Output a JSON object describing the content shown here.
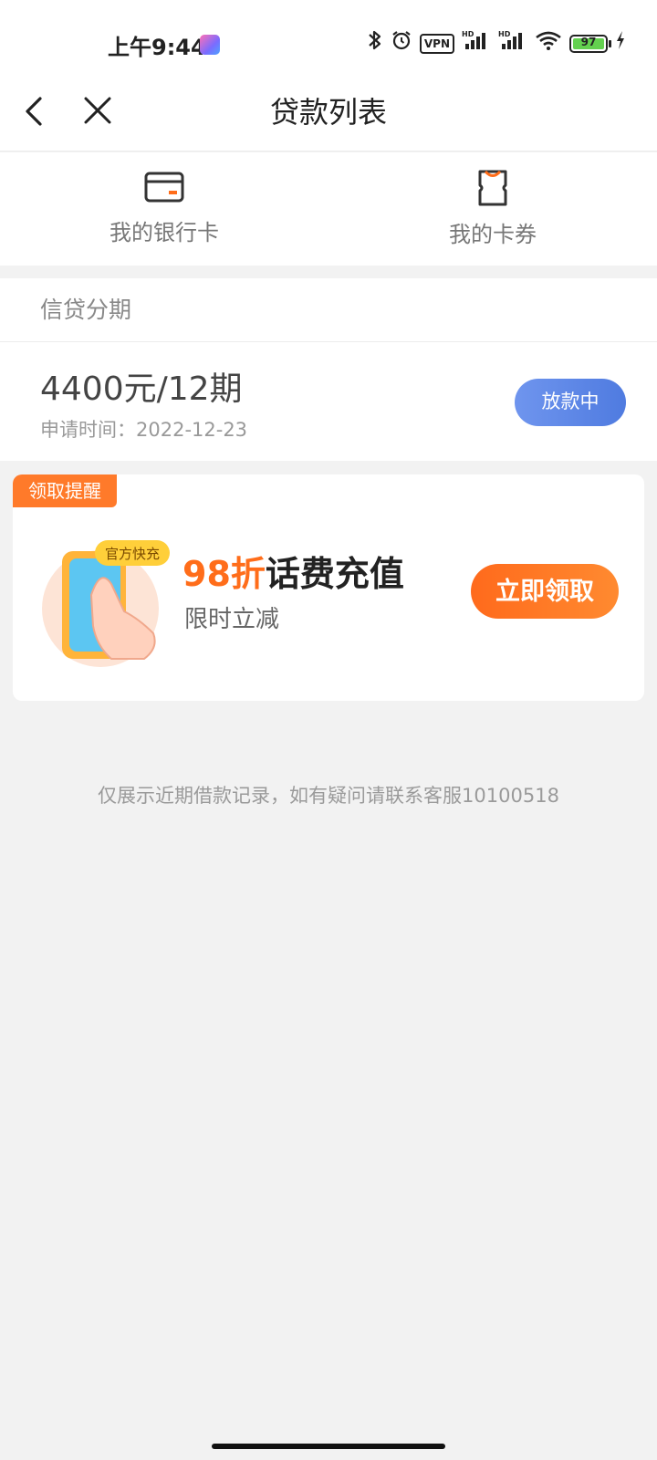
{
  "status_bar": {
    "time": "上午9:44",
    "vpn": "VPN",
    "battery": "97",
    "icons": [
      "bluetooth-icon",
      "alarm-icon",
      "vpn-icon",
      "signal-hd-icon",
      "signal-hd-icon",
      "wifi-icon",
      "battery-icon",
      "charging-icon"
    ]
  },
  "nav": {
    "title": "贷款列表",
    "back_icon": "chevron-left-icon",
    "close_icon": "close-icon"
  },
  "quick_entries": [
    {
      "label": "我的银行卡",
      "icon": "bank-card-icon"
    },
    {
      "label": "我的卡券",
      "icon": "coupon-icon"
    }
  ],
  "loan_section": {
    "header": "信贷分期",
    "items": [
      {
        "amount": "4400元/12期",
        "apply_date": "申请时间：2022-12-23",
        "status": "放款中"
      }
    ]
  },
  "promo": {
    "tag": "领取提醒",
    "badge": "官方快充",
    "title_highlight": "98折",
    "title_rest": "话费充值",
    "subtitle": "限时立减",
    "button": "立即领取",
    "colors": {
      "accent": "#ff6d1a",
      "tag_bg": "#ff7a2a"
    }
  },
  "footer_note": "仅展示近期借款记录，如有疑问请联系客服10100518",
  "colors": {
    "status_button": "#5a85e6",
    "background": "#f2f2f2"
  }
}
